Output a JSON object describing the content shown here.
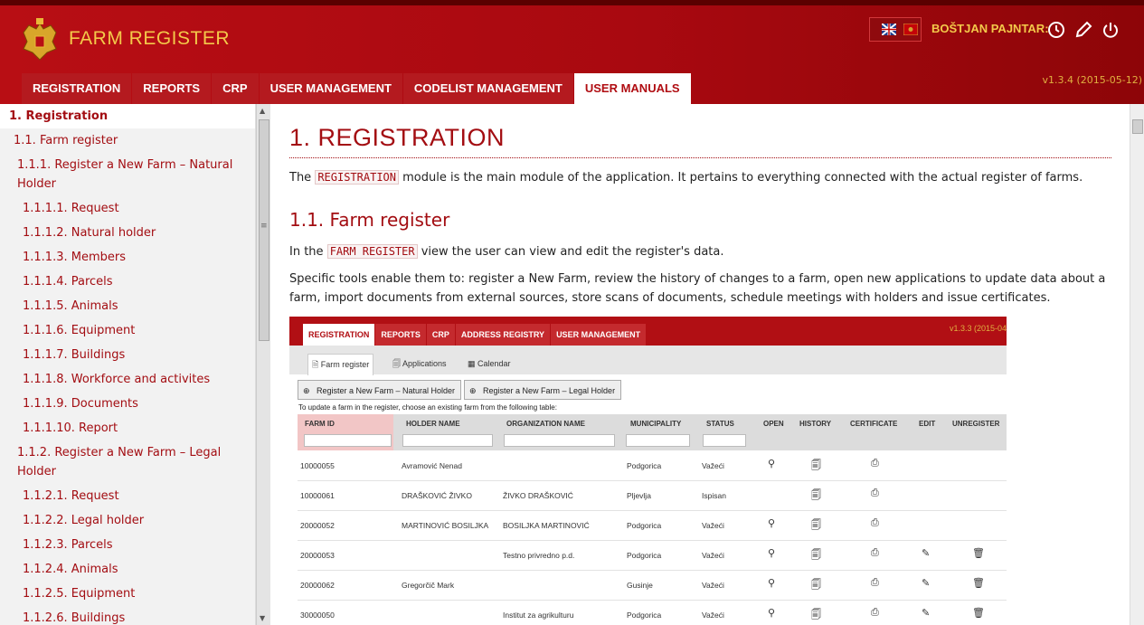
{
  "app": {
    "title": "FARM REGISTER",
    "user": "BOŠTJAN PAJNTAR:",
    "version": "v1.3.4 (2015-05-12)",
    "accent": "#a30d12"
  },
  "nav": {
    "tabs": [
      "REGISTRATION",
      "REPORTS",
      "CRP",
      "USER MANAGEMENT",
      "CODELIST MANAGEMENT",
      "USER MANUALS"
    ],
    "active": "USER MANUALS"
  },
  "toc": [
    "1. Registration",
    "1.1. Farm register",
    "1.1.1. Register a New Farm – Natural Holder",
    "1.1.1.1. Request",
    "1.1.1.2. Natural holder",
    "1.1.1.3. Members",
    "1.1.1.4. Parcels",
    "1.1.1.5. Animals",
    "1.1.1.6. Equipment",
    "1.1.1.7. Buildings",
    "1.1.1.8. Workforce and activites",
    "1.1.1.9. Documents",
    "1.1.1.10. Report",
    "1.1.2. Register a New Farm – Legal Holder",
    "1.1.2.1. Request",
    "1.1.2.2. Legal holder",
    "1.1.2.3. Parcels",
    "1.1.2.4. Animals",
    "1.1.2.5. Equipment",
    "1.1.2.6. Buildings"
  ],
  "doc": {
    "h1": "1. REGISTRATION",
    "p1_pre": "The ",
    "p1_code": "REGISTRATION",
    "p1_post": " module is the main module of the application. It pertains to everything connected with the actual register of farms.",
    "h2": "1.1. Farm register",
    "p2_pre": "In the ",
    "p2_code": "FARM REGISTER",
    "p2_post": " view the user can view and edit the register's data.",
    "p3": "Specific tools enable them to: register a New Farm, review the history of changes to a farm, open new applications to update data about a farm, import documents from external sources, store scans of documents, schedule meetings with holders and issue certificates."
  },
  "screenshot": {
    "tabs": [
      "REGISTRATION",
      "REPORTS",
      "CRP",
      "ADDRESS REGISTRY",
      "USER MANAGEMENT"
    ],
    "version": "v1.3.3 (2015-04",
    "subtabs": [
      "Farm register",
      "Applications",
      "Calendar"
    ],
    "buttons": [
      "Register a New Farm – Natural Holder",
      "Register a New Farm – Legal Holder"
    ],
    "note": "To update a farm in the register, choose an existing farm from the following table:",
    "columns": [
      "FARM ID",
      "HOLDER NAME",
      "ORGANIZATION NAME",
      "MUNICIPALITY",
      "STATUS",
      "OPEN",
      "HISTORY",
      "CERTIFICATE",
      "EDIT",
      "UNREGISTER"
    ],
    "rows": [
      {
        "id": "10000055",
        "holder": "Avramović Nenad",
        "org": "",
        "mun": "Podgorica",
        "status": "Važeći"
      },
      {
        "id": "10000061",
        "holder": "DRAŠKOVIĆ ŽIVKO",
        "org": "ŽIVKO DRAŠKOVIĆ",
        "mun": "Pljevlja",
        "status": "Ispisan"
      },
      {
        "id": "20000052",
        "holder": "MARTINOVIĆ BOSILJKA",
        "org": "BOSILJKA MARTINOVIĆ",
        "mun": "Podgorica",
        "status": "Važeći"
      },
      {
        "id": "20000053",
        "holder": "",
        "org": "Testno privredno p.d.",
        "mun": "Podgorica",
        "status": "Važeći"
      },
      {
        "id": "20000062",
        "holder": "Gregorčič Mark",
        "org": "",
        "mun": "Gusinje",
        "status": "Važeći"
      },
      {
        "id": "30000050",
        "holder": "",
        "org": "Institut za agrikulturu",
        "mun": "Podgorica",
        "status": "Važeći"
      }
    ]
  }
}
